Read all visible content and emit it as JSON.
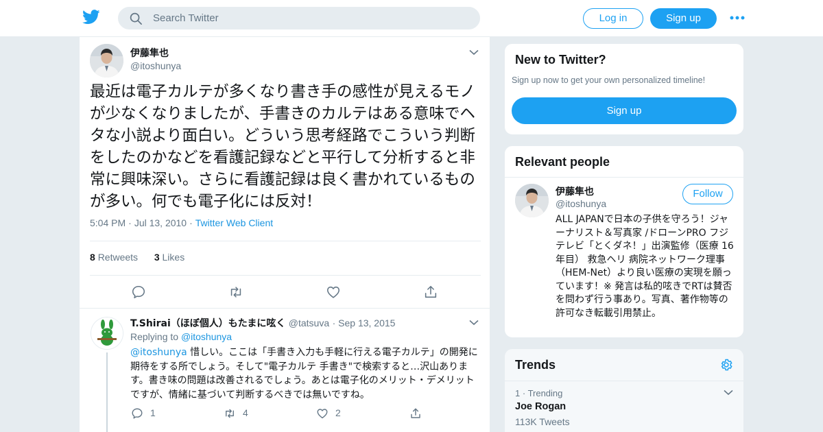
{
  "brand_color": "#1da1f2",
  "header": {
    "logo_icon": "twitter-bird-icon",
    "search_placeholder": "Search Twitter",
    "login_label": "Log in",
    "signup_label": "Sign up",
    "more_icon": "more-dots-icon"
  },
  "tweet": {
    "author_name": "伊藤隼也",
    "author_handle": "@itoshunya",
    "text": "最近は電子カルテが多くなり書き手の感性が見えるモノが少なくなりましたが、手書きのカルテはある意味でヘタな小説より面白い。どういう思考経路でこういう判断をしたのかなどを看護記録などと平行して分析すると非常に興味深い。さらに看護記録は良く書かれているものが多い。何でも電子化には反対！",
    "time": "5:04 PM",
    "date": "Jul 13, 2010",
    "client": "Twitter Web Client",
    "retweets_count": "8",
    "retweets_label": "Retweets",
    "likes_count": "3",
    "likes_label": "Likes"
  },
  "reply": {
    "author_name": "T.Shirai（ほぼ個人）もたまに呟く",
    "author_handle": "@tatsuva",
    "date": "Sep 13, 2015",
    "replying_label": "Replying to",
    "replying_handle": "@itoshunya",
    "mention": "@itoshunya",
    "text": " 惜しい。ここは「手書き入力も手軽に行える電子カルテ」の開発に期待をする所でしょう。そして\"電子カルテ 手書き\"で検索すると…沢山あります。書き味の問題は改善されるでしょう。あとは電子化のメリット・デメリットですが、情緒に基づいて判断するべきでは無いですね。",
    "reply_count": "1",
    "retweet_count": "4",
    "like_count": "2"
  },
  "sidebar": {
    "new_title": "New to Twitter?",
    "new_subtitle": "Sign up now to get your own personalized timeline!",
    "new_signup_label": "Sign up",
    "relevant_title": "Relevant people",
    "person_name": "伊藤隼也",
    "person_handle": "@itoshunya",
    "follow_label": "Follow",
    "person_bio": "ALL JAPANで日本の子供を守ろう！ジャーナリスト＆写真家 /ドローンPRO フジテレビ「とくダネ！」出演監修（医療 16年目） 救急ヘリ 病院ネットワーク理事（HEM-Net）より良い医療の実現を願っています！※ 発言は私的呟きでRTは賛否を問わず行う事あり。写真、著作物等の許可なき転載引用禁止。",
    "trends_title": "Trends",
    "trend_rank": "1",
    "trend_label": "Trending",
    "trend_name": "Joe Rogan",
    "trend_count": "113K Tweets"
  }
}
